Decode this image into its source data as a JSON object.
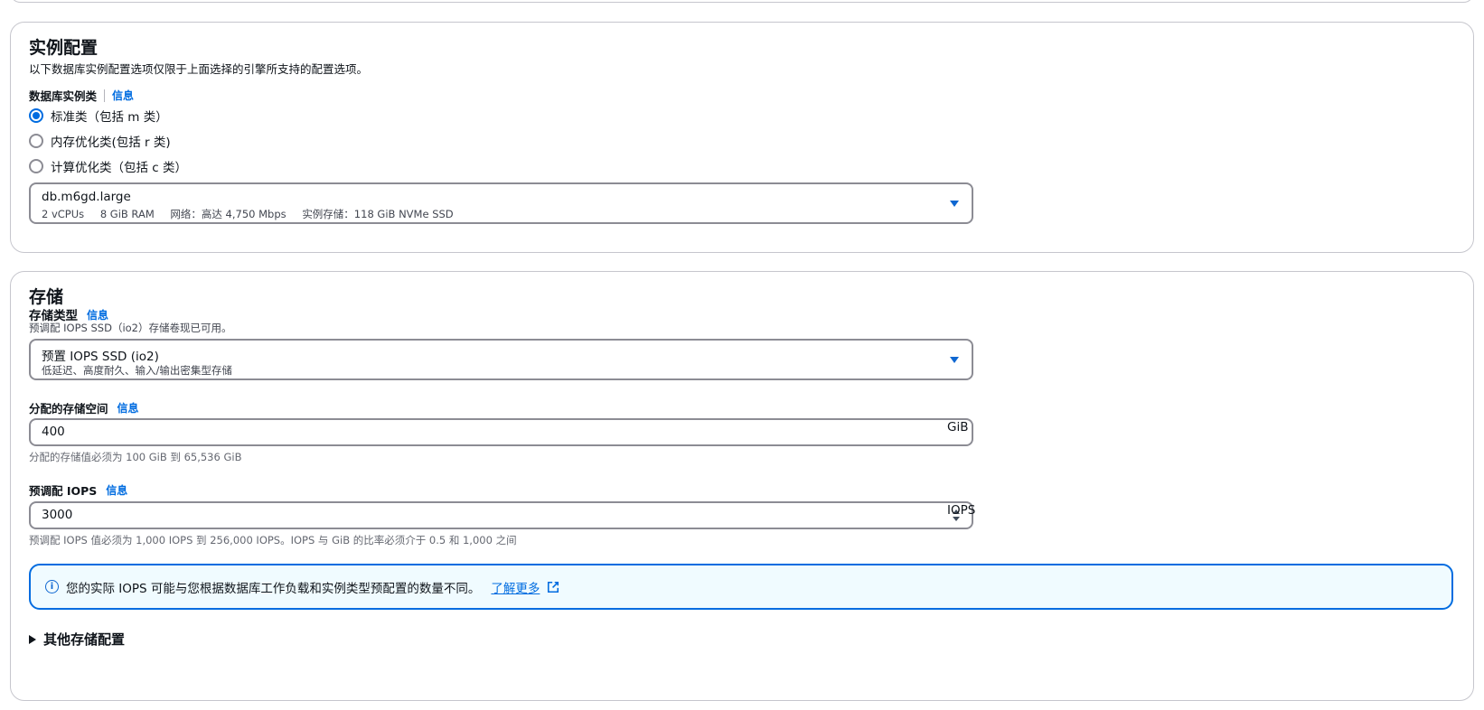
{
  "instance_config": {
    "title": "实例配置",
    "description": "以下数据库实例配置选项仅限于上面选择的引擎所支持的配置选项。",
    "class_label": "数据库实例类",
    "info_link": "信息",
    "radio_options": [
      {
        "label": "标准类（包括 m 类）",
        "checked": true
      },
      {
        "label": "内存优化类(包括 r 类)",
        "checked": false
      },
      {
        "label": "计算优化类（包括 c 类）",
        "checked": false
      }
    ],
    "select": {
      "value": "db.m6gd.large",
      "details": [
        "2 vCPUs",
        "8 GiB RAM",
        "网络：高达 4,750 Mbps",
        "实例存储：118 GiB NVMe SSD"
      ]
    }
  },
  "storage": {
    "title": "存储",
    "type_label": "存储类型",
    "info_link": "信息",
    "type_hint": "预调配 IOPS SSD（io2）存储卷现已可用。",
    "type_select": {
      "value": "预置 IOPS SSD (io2)",
      "detail": "低延迟、高度耐久、输入/输出密集型存储"
    },
    "allocated_label": "分配的存储空间",
    "allocated_value": "400",
    "allocated_unit": "GiB",
    "allocated_hint": "分配的存储值必须为 100 GiB 到 65,536 GiB",
    "iops_label": "预调配 IOPS",
    "iops_value": "3000",
    "iops_unit": "IOPS",
    "iops_hint": "预调配 IOPS 值必须为 1,000 IOPS 到 256,000 IOPS。IOPS 与 GiB 的比率必须介于 0.5 和 1,000 之间",
    "alert_text": "您的实际 IOPS 可能与您根据数据库工作负载和实例类型预配置的数量不同。",
    "alert_link": "了解更多",
    "alert_icon": "i",
    "expander_label": "其他存储配置"
  },
  "colors": {
    "accent": "#006ce0",
    "alert_bg": "#f0fbff",
    "border": "#8c8c94"
  }
}
